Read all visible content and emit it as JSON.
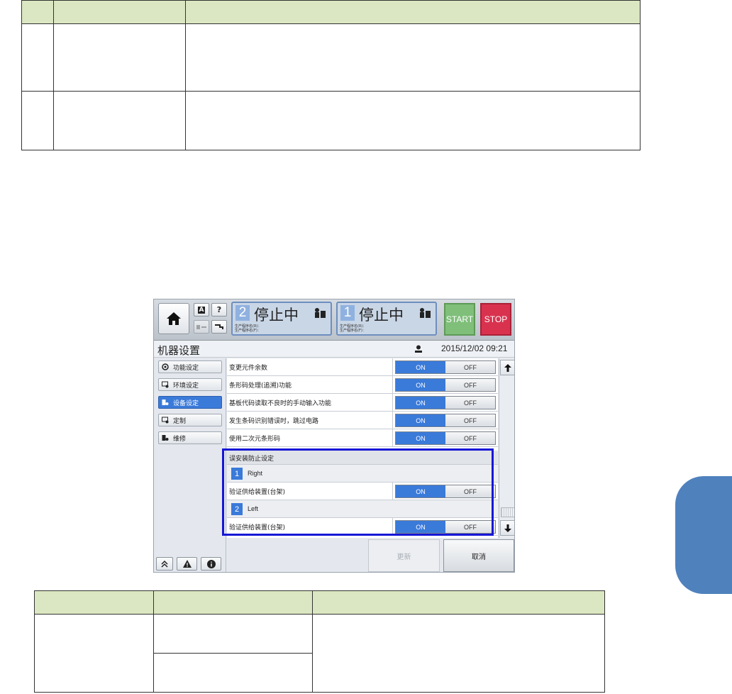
{
  "colors": {
    "table_header": "#dbe7c2",
    "side_tab": "#4f81bd",
    "accent_blue": "#3a7ad9",
    "start_green": "#7fbf7a",
    "stop_red": "#d9324f",
    "highlight_box": "#1717d6"
  },
  "machine": {
    "topbar": {
      "home_icon": "home-icon",
      "small_buttons": [
        "A",
        "?"
      ],
      "lane2": {
        "number": "2",
        "status": "停止中",
        "line1": "生产程序名(R)：",
        "line2": "生产程序名(F)："
      },
      "lane1": {
        "number": "1",
        "status": "停止中",
        "line1": "生产程序名(R)：",
        "line2": "生产程序名(F)："
      },
      "start_label": "START",
      "stop_label": "STOP"
    },
    "title": "机器设置",
    "datetime": "2015/12/02 09:21",
    "sidebar": [
      {
        "label": "功能设定",
        "icon": "function-icon",
        "active": false
      },
      {
        "label": "环境设定",
        "icon": "environment-icon",
        "active": false
      },
      {
        "label": "设备设定",
        "icon": "device-icon",
        "active": true
      },
      {
        "label": "定制",
        "icon": "custom-icon",
        "active": false
      },
      {
        "label": "维修",
        "icon": "maintenance-icon",
        "active": false
      }
    ],
    "bottom_icons": [
      "double-up-icon",
      "warning-icon",
      "info-icon"
    ],
    "rows": [
      {
        "label": "变更元件余数",
        "on": "ON",
        "off": "OFF"
      },
      {
        "label": "条形码处理(追溯)功能",
        "on": "ON",
        "off": "OFF"
      },
      {
        "label": "基板代码读取不良时的手动输入功能",
        "on": "ON",
        "off": "OFF"
      },
      {
        "label": "发生条码识别错误时，跳过电路",
        "on": "ON",
        "off": "OFF"
      },
      {
        "label": "使用二次元条形码",
        "on": "ON",
        "off": "OFF"
      }
    ],
    "group": {
      "title": "误安装防止设定",
      "lanes": [
        {
          "number": "1",
          "name": "Right",
          "row_label": "验证供给装置(台架)",
          "on": "ON",
          "off": "OFF"
        },
        {
          "number": "2",
          "name": "Left",
          "row_label": "验证供给装置(台架)",
          "on": "ON",
          "off": "OFF"
        }
      ]
    },
    "update_label": "更新",
    "cancel_label": "取消"
  }
}
